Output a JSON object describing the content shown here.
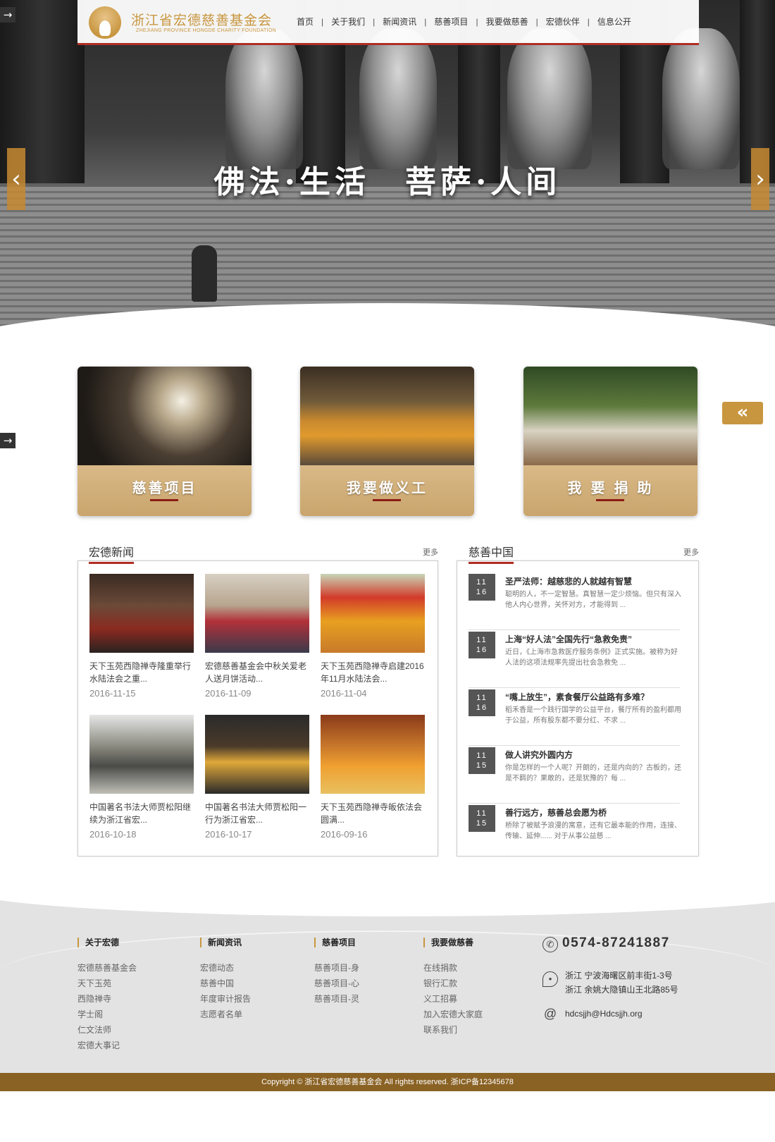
{
  "header": {
    "logo_cn": "浙江省宏德慈善基金会",
    "logo_en": "ZHEJIANG PROVINCE HONGDE CHARITY FOUNDATION",
    "nav": [
      "首页",
      "关于我们",
      "新闻资讯",
      "慈善项目",
      "我要做慈善",
      "宏德伙伴",
      "信息公开"
    ]
  },
  "hero": {
    "slogan": "佛法·生活　菩萨·人间",
    "prev_arrow": "‹",
    "next_arrow": "›"
  },
  "side_tab_arrow": "→",
  "back_button": "«",
  "cards": [
    {
      "label": "慈善项目"
    },
    {
      "label": "我要做义工"
    },
    {
      "label": "我 要 捐 助"
    }
  ],
  "news": {
    "title": "宏德新闻",
    "more": "更多",
    "items": [
      {
        "title": "天下玉苑西隐禅寺隆重举行水陆法会之重...",
        "date": "2016-11-15"
      },
      {
        "title": "宏德慈善基金会中秋关爱老人送月饼活动...",
        "date": "2016-11-09"
      },
      {
        "title": "天下玉苑西隐禅寺启建2016年11月水陆法会...",
        "date": "2016-11-04"
      },
      {
        "title": "中国著名书法大师贾松阳继续为浙江省宏...",
        "date": "2016-10-18"
      },
      {
        "title": "中国著名书法大师贾松阳一行为浙江省宏...",
        "date": "2016-10-17"
      },
      {
        "title": "天下玉苑西隐禅寺皈依法会圆满...",
        "date": "2016-09-16"
      }
    ]
  },
  "charity": {
    "title": "慈善中国",
    "more": "更多",
    "items": [
      {
        "month": "11",
        "day": "16",
        "title": "圣严法师：越慈悲的人就越有智慧",
        "summary": "聪明的人，不一定智慧。真智慧一定少烦恼。但只有深入他人内心世界，关怀对方，才能得到 ..."
      },
      {
        "month": "11",
        "day": "16",
        "title": "上海“好人法”全国先行“急救免责”",
        "summary": "近日，《上海市急救医疗服务条例》正式实施。被称为好人法的这项法规率先提出社会急救免 ..."
      },
      {
        "month": "11",
        "day": "16",
        "title": "“嘴上放生”，素食餐厅公益路有多难？",
        "summary": "稻禾香是一个践行国学的公益平台，餐厅所有的盈利都用于公益，所有股东都不要分红、不求 ..."
      },
      {
        "month": "11",
        "day": "15",
        "title": "做人讲究外圆内方",
        "summary": "你是怎样的一个人呢？开朗的，还是内向的？古板的，还是不羁的？果敢的，还是犹豫的？每 ..."
      },
      {
        "month": "11",
        "day": "15",
        "title": "善行远方，慈善总会愿为桥",
        "summary": "桥除了被赋予浪漫的寓意，还有它最本能的作用，连接、传输、延伸...... 对于从事公益慈 ..."
      }
    ]
  },
  "footer": {
    "cols": [
      {
        "heading": "关于宏德",
        "links": [
          "宏德慈善基金会",
          "天下玉苑",
          "西隐禅寺",
          "学士阁",
          "仁文法师",
          "宏德大事记"
        ]
      },
      {
        "heading": "新闻资讯",
        "links": [
          "宏德动态",
          "慈善中国",
          "年度审计报告",
          "志愿者名单"
        ]
      },
      {
        "heading": "慈善项目",
        "links": [
          "慈善项目-身",
          "慈善项目-心",
          "慈善项目-灵"
        ]
      },
      {
        "heading": "我要做慈善",
        "links": [
          "在线捐款",
          "银行汇款",
          "义工招募",
          "加入宏德大家庭",
          "联系我们"
        ]
      }
    ],
    "phone": "0574-87241887",
    "address_lines": [
      "浙江 宁波海曙区前丰街1-3号",
      "浙江 余姚大隐镇山王北路85号"
    ],
    "email": "hdcsjjh@Hdcsjjh.org",
    "copyright": "Copyright © 浙江省宏德慈善基金会 All rights reserved. 浙ICP备12345678"
  }
}
